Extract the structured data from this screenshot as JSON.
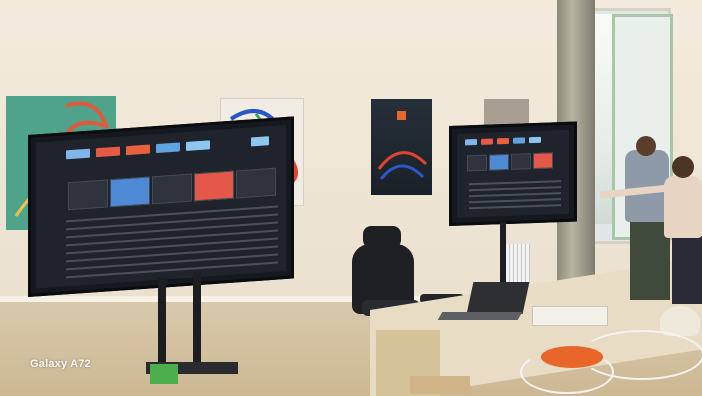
{
  "photo": {
    "watermark": "Galaxy A72"
  },
  "colors": {
    "wall": "#efe6d6",
    "screen": "#1f232b",
    "accent_orange": "#e9662a",
    "poster_green": "#4fa38a"
  },
  "icons": [
    "tv-screen-icon",
    "office-chair-icon",
    "laptop-icon"
  ]
}
